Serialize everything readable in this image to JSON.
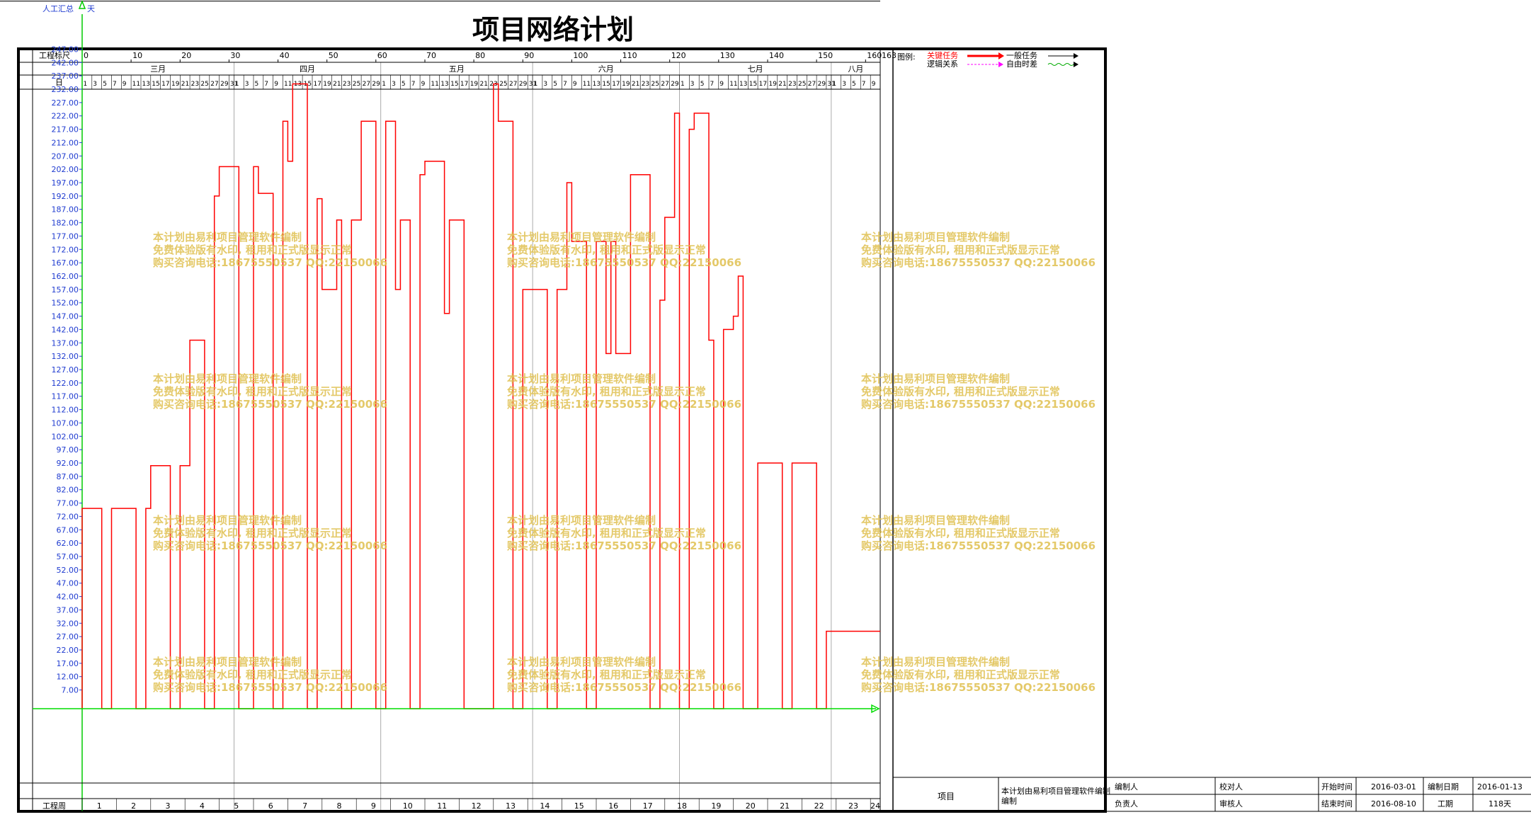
{
  "header": {
    "top_label": "人工汇总",
    "top_unit": "天",
    "title": "项目网络计划"
  },
  "timescale": {
    "row_label": "工程标尺",
    "ticks": [
      "0",
      "10",
      "20",
      "30",
      "40",
      "50",
      "60",
      "70",
      "80",
      "90",
      "100",
      "110",
      "120",
      "130",
      "140",
      "150",
      "160",
      "163"
    ],
    "months": [
      "三月",
      "四月",
      "五月",
      "六月",
      "七月",
      "八月"
    ],
    "days_row_label": "日",
    "week_row_label": "工程周",
    "weeks": [
      "1",
      "2",
      "3",
      "4",
      "5",
      "6",
      "7",
      "8",
      "9",
      "10",
      "11",
      "12",
      "13",
      "14",
      "15",
      "16",
      "17",
      "18",
      "19",
      "20",
      "21",
      "22",
      "23",
      "24"
    ]
  },
  "legend": {
    "title": "图例:",
    "critical": "关键任务",
    "logic": "逻辑关系",
    "normal": "一般任务",
    "free_float": "自由时差",
    "critical_color": "#ff0000",
    "logic_color": "#ff00ff",
    "normal_color": "#000000",
    "free_float_color": "#00aa00"
  },
  "watermark": {
    "line1": "本计划由易利项目管理软件编制",
    "line2": "免费体验版有水印, 租用和正式版显示正常",
    "line3": "购买咨询电话:18675550537 QQ:22150066"
  },
  "chart_data": {
    "type": "line",
    "title": "项目网络计划",
    "xlabel": "工程标尺",
    "ylabel": "人工汇总",
    "xlim": [
      0,
      163
    ],
    "ylim": [
      0,
      232
    ],
    "y_ticks": [
      "7.00",
      "12.00",
      "17.00",
      "22.00",
      "27.00",
      "32.00",
      "37.00",
      "42.00",
      "47.00",
      "52.00",
      "57.00",
      "62.00",
      "67.00",
      "72.00",
      "77.00",
      "82.00",
      "87.00",
      "92.00",
      "97.00",
      "102.00",
      "107.00",
      "112.00",
      "117.00",
      "122.00",
      "127.00",
      "132.00",
      "137.00",
      "142.00",
      "147.00",
      "152.00",
      "157.00",
      "162.00",
      "167.00",
      "172.00",
      "177.00",
      "182.00",
      "187.00",
      "192.00",
      "197.00",
      "202.00",
      "207.00",
      "212.00",
      "217.00",
      "222.00",
      "227.00",
      "232.00",
      "237.00",
      "242.00",
      "247.00"
    ],
    "series": [
      {
        "color": "#ff0000",
        "points": [
          [
            0,
            0
          ],
          [
            0,
            75
          ],
          [
            4,
            75
          ],
          [
            4,
            0
          ],
          [
            6,
            0
          ],
          [
            6,
            75
          ],
          [
            11,
            75
          ],
          [
            11,
            0
          ],
          [
            13,
            0
          ],
          [
            13,
            75
          ],
          [
            14,
            75
          ],
          [
            14,
            91
          ],
          [
            18,
            91
          ],
          [
            18,
            0
          ],
          [
            20,
            0
          ],
          [
            20,
            91
          ],
          [
            22,
            91
          ],
          [
            22,
            138
          ],
          [
            25,
            138
          ],
          [
            25,
            0
          ],
          [
            27,
            0
          ],
          [
            27,
            192
          ],
          [
            28,
            192
          ],
          [
            28,
            203
          ],
          [
            32,
            203
          ],
          [
            32,
            0
          ],
          [
            35,
            0
          ],
          [
            35,
            203
          ],
          [
            36,
            203
          ],
          [
            36,
            193
          ],
          [
            39,
            193
          ],
          [
            39,
            0
          ],
          [
            41,
            0
          ],
          [
            41,
            220
          ],
          [
            42,
            220
          ],
          [
            42,
            205
          ],
          [
            43,
            205
          ],
          [
            43,
            234
          ],
          [
            46,
            234
          ],
          [
            46,
            0
          ],
          [
            48,
            0
          ],
          [
            48,
            191
          ],
          [
            49,
            191
          ],
          [
            49,
            157
          ],
          [
            52,
            157
          ],
          [
            52,
            183
          ],
          [
            53,
            183
          ],
          [
            53,
            0
          ],
          [
            55,
            0
          ],
          [
            55,
            183
          ],
          [
            57,
            183
          ],
          [
            57,
            220
          ],
          [
            60,
            220
          ],
          [
            60,
            0
          ],
          [
            62,
            0
          ],
          [
            62,
            220
          ],
          [
            64,
            220
          ],
          [
            64,
            157
          ],
          [
            65,
            157
          ],
          [
            65,
            183
          ],
          [
            67,
            183
          ],
          [
            67,
            0
          ],
          [
            69,
            0
          ],
          [
            69,
            200
          ],
          [
            70,
            200
          ],
          [
            70,
            205
          ],
          [
            74,
            205
          ],
          [
            74,
            148
          ],
          [
            75,
            148
          ],
          [
            75,
            183
          ],
          [
            78,
            183
          ],
          [
            78,
            0
          ],
          [
            84,
            0
          ],
          [
            84,
            234
          ],
          [
            85,
            234
          ],
          [
            85,
            220
          ],
          [
            88,
            220
          ],
          [
            88,
            0
          ],
          [
            90,
            0
          ],
          [
            90,
            157
          ],
          [
            95,
            157
          ],
          [
            95,
            0
          ],
          [
            97,
            0
          ],
          [
            97,
            157
          ],
          [
            99,
            157
          ],
          [
            99,
            197
          ],
          [
            100,
            197
          ],
          [
            100,
            175
          ],
          [
            103,
            175
          ],
          [
            103,
            0
          ],
          [
            105,
            0
          ],
          [
            105,
            175
          ],
          [
            107,
            175
          ],
          [
            107,
            133
          ],
          [
            108,
            133
          ],
          [
            108,
            175
          ],
          [
            109,
            175
          ],
          [
            109,
            133
          ],
          [
            112,
            133
          ],
          [
            112,
            200
          ],
          [
            116,
            200
          ],
          [
            116,
            0
          ],
          [
            118,
            0
          ],
          [
            118,
            153
          ],
          [
            119,
            153
          ],
          [
            119,
            184
          ],
          [
            121,
            184
          ],
          [
            121,
            223
          ],
          [
            122,
            223
          ],
          [
            122,
            0
          ],
          [
            124,
            0
          ],
          [
            124,
            217
          ],
          [
            125,
            217
          ],
          [
            125,
            223
          ],
          [
            128,
            223
          ],
          [
            128,
            138
          ],
          [
            129,
            138
          ],
          [
            129,
            0
          ],
          [
            131,
            0
          ],
          [
            131,
            142
          ],
          [
            133,
            142
          ],
          [
            133,
            147
          ],
          [
            134,
            147
          ],
          [
            134,
            162
          ],
          [
            135,
            162
          ],
          [
            135,
            0
          ],
          [
            138,
            0
          ],
          [
            138,
            92
          ],
          [
            143,
            92
          ],
          [
            143,
            0
          ],
          [
            145,
            0
          ],
          [
            145,
            92
          ],
          [
            150,
            92
          ],
          [
            150,
            0
          ],
          [
            152,
            0
          ],
          [
            152,
            29
          ],
          [
            163,
            29
          ]
        ]
      }
    ],
    "baseline_color": "#00dd00",
    "grid": false
  },
  "title_block": {
    "project_label": "项目",
    "project_value": "本计划由易利项目管理软件编制",
    "editor": "编制人",
    "checker": "校对人",
    "start_label": "开始时间",
    "start_value": "2016-03-01",
    "edit_date_label": "编制日期",
    "edit_date_value": "2016-01-13",
    "owner": "负责人",
    "reviewer": "审核人",
    "end_label": "结束时间",
    "end_value": "2016-08-10",
    "duration_label": "工期",
    "duration_value": "118天"
  }
}
